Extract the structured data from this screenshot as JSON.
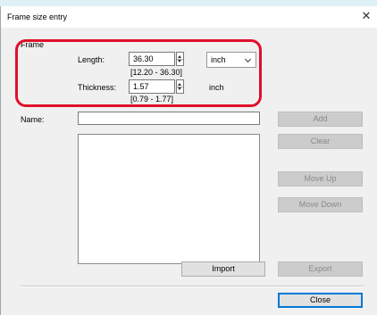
{
  "window": {
    "title": "Frame size entry"
  },
  "frame": {
    "group_label": "Frame",
    "length": {
      "label": "Length:",
      "value": "36.30",
      "range": "[12.20 - 36.30]"
    },
    "thickness": {
      "label": "Thickness:",
      "value": "1.57",
      "range": "[0.79 - 1.77]",
      "unit": "inch"
    },
    "unit_select": {
      "value": "inch"
    }
  },
  "name": {
    "label": "Name:",
    "value": ""
  },
  "buttons": {
    "add": "Add",
    "clear": "Clear",
    "move_up": "Move Up",
    "move_down": "Move Down",
    "import": "Import",
    "export": "Export",
    "close": "Close"
  },
  "colors": {
    "highlight": "#e0102a",
    "default_button_border": "#0078d7"
  },
  "icons": {
    "close": "close-icon",
    "spin": "spinner-icon",
    "dropdown": "chevron-down-icon"
  }
}
